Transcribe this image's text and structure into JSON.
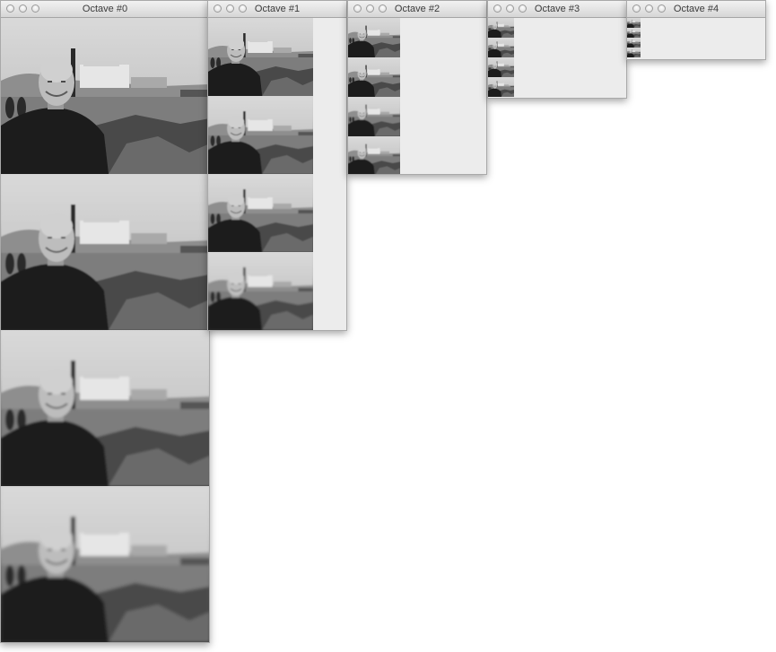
{
  "windows": [
    {
      "title": "Octave #0",
      "octave": 0,
      "image_count": 4
    },
    {
      "title": "Octave #1",
      "octave": 1,
      "image_count": 4
    },
    {
      "title": "Octave #2",
      "octave": 2,
      "image_count": 4
    },
    {
      "title": "Octave #3",
      "octave": 3,
      "image_count": 4
    },
    {
      "title": "Octave #4",
      "octave": 4,
      "image_count": 4
    }
  ],
  "image_subject": "grayscale portrait of smiling bald man in dark sweater in front of harbor with ferry boat and rocks",
  "icons": {
    "close": "close-button-icon",
    "minimize": "minimize-button-icon",
    "zoom": "zoom-button-icon"
  },
  "colors": {
    "window_bg": "#ececec",
    "titlebar_top": "#f2f2f2",
    "titlebar_bottom": "#d6d6d6",
    "title_text": "#3a3a3a"
  }
}
